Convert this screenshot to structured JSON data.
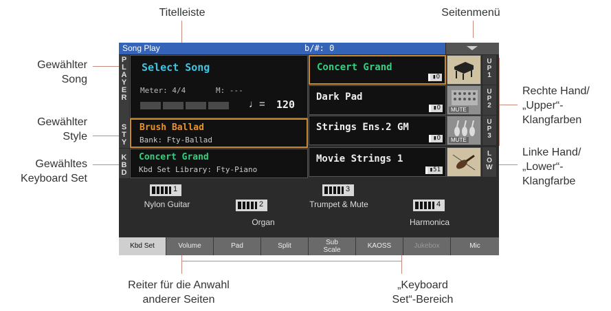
{
  "callouts": {
    "titelleiste": "Titelleiste",
    "seitenmenue": "Seitenmenü",
    "song_1": "Gewählter",
    "song_2": "Song",
    "style_1": "Gewählter",
    "style_2": "Style",
    "kbdset_1": "Gewähltes",
    "kbdset_2": "Keyboard Set",
    "upper_1": "Rechte Hand/",
    "upper_2": "„Upper“-",
    "upper_3": "Klangfarben",
    "lower_1": "Linke Hand/",
    "lower_2": "„Lower“-",
    "lower_3": "Klangfarbe",
    "tabs_1": "Reiter für die Anwahl",
    "tabs_2": "anderer Seiten",
    "area_1": "„Keyboard",
    "area_2": "Set“-Bereich"
  },
  "screen": {
    "title": "Song Play",
    "key": "b/#: 0",
    "player_tab": [
      "P",
      "L",
      "A",
      "Y",
      "E",
      "R"
    ],
    "style_tab": [
      "S",
      "T",
      "Y"
    ],
    "kbd_tab": [
      "K",
      "B",
      "D"
    ],
    "song_name": "Select Song",
    "meter": "Meter: 4/4",
    "measure": "M:  ---",
    "tempo_symbol": "♩=",
    "tempo": "120",
    "style_name": "Brush Ballad",
    "style_bank": "Bank: Fty-Ballad",
    "kbdset_name": "Concert Grand",
    "kbdset_library": "Kbd Set Library: Fty-Piano",
    "sounds": [
      {
        "name": "Concert Grand",
        "ind": "▮O",
        "tab": [
          "U",
          "P",
          "1"
        ]
      },
      {
        "name": "Dark Pad",
        "ind": "▮O",
        "tab": [
          "U",
          "P",
          "2"
        ],
        "mute": "MUTE"
      },
      {
        "name": "Strings Ens.2 GM",
        "ind": "▮O",
        "tab": [
          "U",
          "P",
          "3"
        ],
        "mute": "MUTE"
      },
      {
        "name": "Movie Strings 1",
        "ind": "▮51",
        "tab": [
          "L",
          "O",
          "W"
        ]
      }
    ],
    "kbd_slots": [
      {
        "num": "1",
        "name": "Nylon Guitar"
      },
      {
        "num": "2",
        "name": "Organ"
      },
      {
        "num": "3",
        "name": "Trumpet & Mute"
      },
      {
        "num": "4",
        "name": "Harmonica"
      }
    ],
    "tabs": [
      "Kbd Set",
      "Volume",
      "Pad",
      "Split",
      "Sub Scale",
      "KAOSS",
      "Jukebox",
      "Mic"
    ]
  }
}
